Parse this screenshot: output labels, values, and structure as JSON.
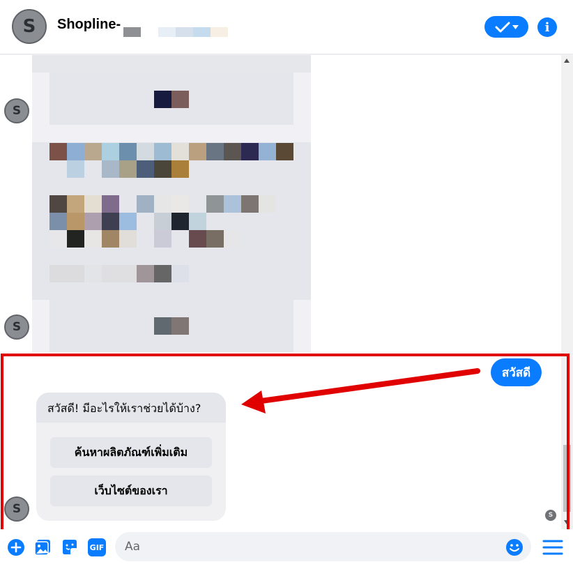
{
  "header": {
    "avatar_letter": "S",
    "contact_name": "Shopline-",
    "done_button": "check-dropdown",
    "info_button": "i"
  },
  "thread": {
    "avatar_letter": "S",
    "sent_message": "สวัสดี",
    "bot_reply": {
      "text": "สวัสดี! มีอะไรให้เราช่วยได้บ้าง?",
      "quick_replies": [
        "ค้นหาผลิตภัณฑ์เพิ่มเติม",
        "เว็บไซต์ของเรา"
      ]
    },
    "seen_avatar_letter": "S"
  },
  "composer": {
    "placeholder": "Aa",
    "icons": [
      "add-icon",
      "photo-icon",
      "sticker-icon",
      "gif-icon",
      "emoji-icon",
      "menu-icon"
    ],
    "gif_label": "GIF"
  },
  "colors": {
    "accent": "#0a7cff",
    "highlight": "#e00000",
    "bubble_gray": "#e4e6eb"
  }
}
